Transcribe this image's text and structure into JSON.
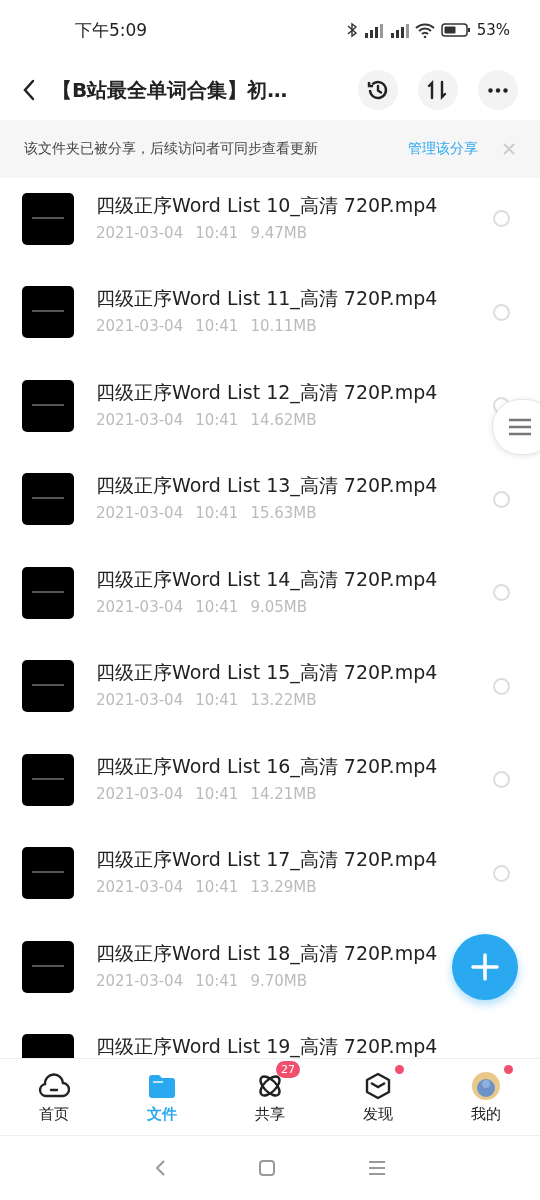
{
  "status_bar": {
    "time": "下午5:09",
    "battery": "53%"
  },
  "header": {
    "title": "【B站最全单词合集】初…"
  },
  "share_banner": {
    "message": "该文件夹已被分享，后续访问者可同步查看更新",
    "action": "管理该分享"
  },
  "files": [
    {
      "name": "四级正序Word List 10_高清 720P.mp4",
      "date": "2021-03-04",
      "time": "10:41",
      "size": "9.47MB",
      "selected": false
    },
    {
      "name": "四级正序Word List 11_高清 720P.mp4",
      "date": "2021-03-04",
      "time": "10:41",
      "size": "10.11MB",
      "selected": false
    },
    {
      "name": "四级正序Word List 12_高清 720P.mp4",
      "date": "2021-03-04",
      "time": "10:41",
      "size": "14.62MB",
      "selected": false
    },
    {
      "name": "四级正序Word List 13_高清 720P.mp4",
      "date": "2021-03-04",
      "time": "10:41",
      "size": "15.63MB",
      "selected": false
    },
    {
      "name": "四级正序Word List 14_高清 720P.mp4",
      "date": "2021-03-04",
      "time": "10:41",
      "size": "9.05MB",
      "selected": false
    },
    {
      "name": "四级正序Word List 15_高清 720P.mp4",
      "date": "2021-03-04",
      "time": "10:41",
      "size": "13.22MB",
      "selected": false
    },
    {
      "name": "四级正序Word List 16_高清 720P.mp4",
      "date": "2021-03-04",
      "time": "10:41",
      "size": "14.21MB",
      "selected": false
    },
    {
      "name": "四级正序Word List 17_高清 720P.mp4",
      "date": "2021-03-04",
      "time": "10:41",
      "size": "13.29MB",
      "selected": false
    },
    {
      "name": "四级正序Word List 18_高清 720P.mp4",
      "date": "2021-03-04",
      "time": "10:41",
      "size": "9.70MB"
    },
    {
      "name": "四级正序Word List 19_高清 720P.mp4"
    }
  ],
  "tabs": [
    {
      "kind": "home",
      "label": "首页",
      "selected": false
    },
    {
      "kind": "files",
      "label": "文件",
      "selected": true
    },
    {
      "kind": "share",
      "label": "共享",
      "selected": false,
      "badge": "27"
    },
    {
      "kind": "discover",
      "label": "发现",
      "selected": false,
      "dot": true
    },
    {
      "kind": "me",
      "label": "我的",
      "selected": false,
      "dot": true
    }
  ]
}
